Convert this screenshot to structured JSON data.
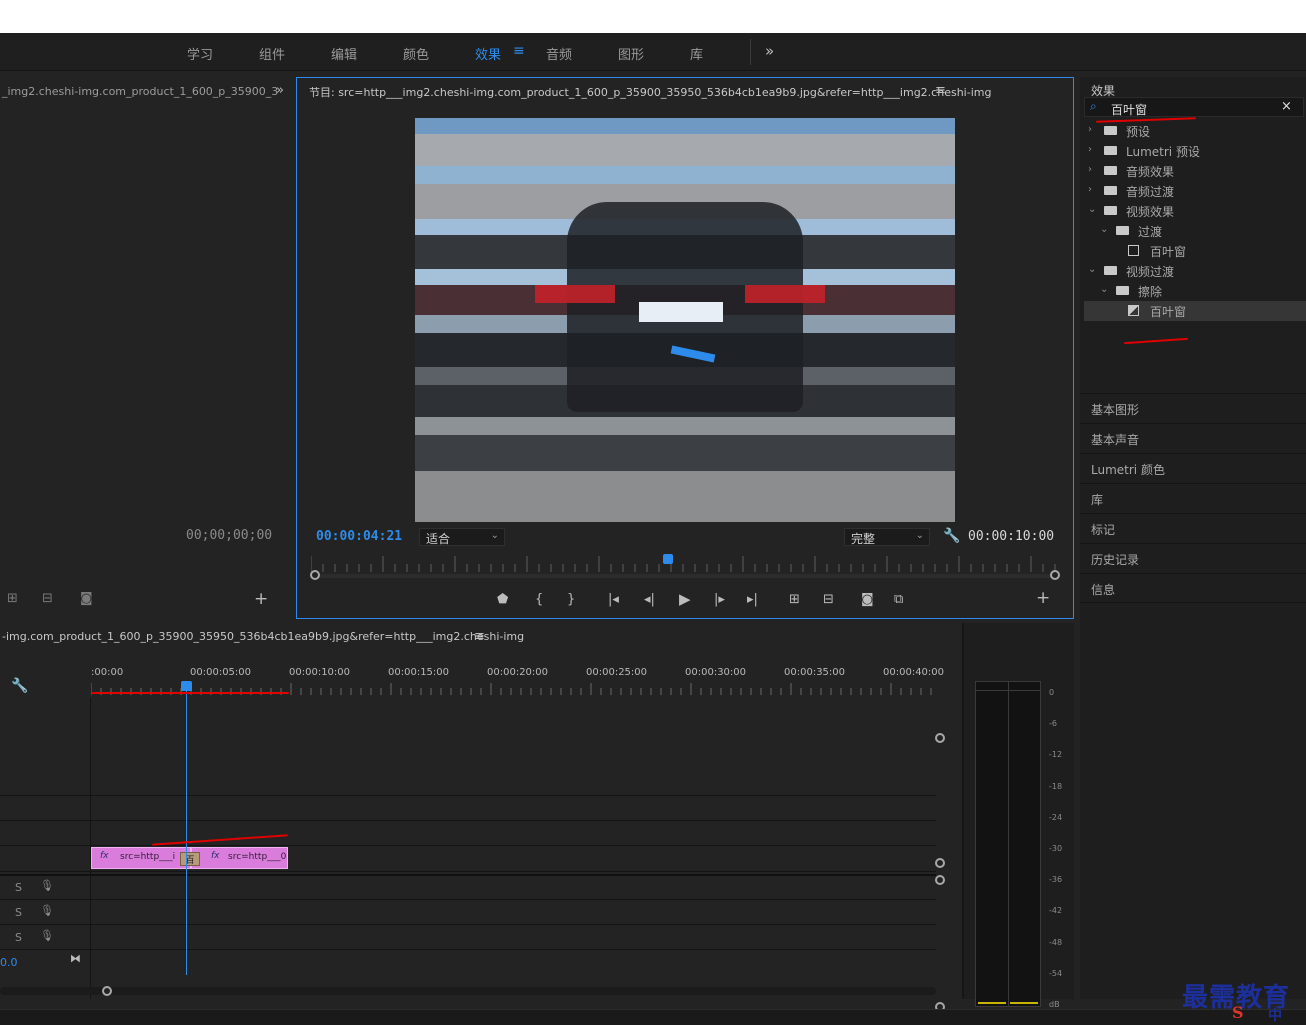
{
  "workspace": {
    "tabs": [
      "学习",
      "组件",
      "编辑",
      "颜色",
      "效果",
      "音频",
      "图形",
      "库"
    ],
    "active": "效果",
    "more_label": "»"
  },
  "source": {
    "title": "_img2.cheshi-img.com_product_1_600_p_35900_3",
    "more": "»",
    "timecode": "00;00;00;00",
    "add": "+"
  },
  "program": {
    "title": "节目: src=http___img2.cheshi-img.com_product_1_600_p_35900_35950_536b4cb1ea9b9.jpg&refer=http___img2.cheshi-img",
    "menu": "≡",
    "current_tc": "00:00:04:21",
    "fit": "适合",
    "quality": "完整",
    "duration_tc": "00:00:10:00",
    "add": "+",
    "playhead_fraction": 0.479
  },
  "effects": {
    "title": "效果",
    "search_value": "百叶窗",
    "clear": "×",
    "tree": [
      {
        "label": "预设",
        "depth": 0,
        "arrow": "›",
        "type": "folder-star"
      },
      {
        "label": "Lumetri 预设",
        "depth": 0,
        "arrow": "›",
        "type": "folder-star"
      },
      {
        "label": "音频效果",
        "depth": 0,
        "arrow": "›",
        "type": "folder"
      },
      {
        "label": "音频过渡",
        "depth": 0,
        "arrow": "›",
        "type": "folder"
      },
      {
        "label": "视频效果",
        "depth": 0,
        "arrow": "⌄",
        "type": "folder"
      },
      {
        "label": "过渡",
        "depth": 1,
        "arrow": "⌄",
        "type": "folder"
      },
      {
        "label": "百叶窗",
        "depth": 2,
        "arrow": "",
        "type": "effect"
      },
      {
        "label": "视频过渡",
        "depth": 0,
        "arrow": "⌄",
        "type": "folder"
      },
      {
        "label": "擦除",
        "depth": 1,
        "arrow": "⌄",
        "type": "folder"
      },
      {
        "label": "百叶窗",
        "depth": 2,
        "arrow": "",
        "type": "transition",
        "selected": true
      }
    ]
  },
  "right_panels": [
    "基本图形",
    "基本声音",
    "Lumetri 颜色",
    "库",
    "标记",
    "历史记录",
    "信息"
  ],
  "timeline": {
    "title": "-img.com_product_1_600_p_35900_35950_536b4cb1ea9b9.jpg&refer=http___img2.cheshi-img",
    "menu": "≡",
    "ruler": [
      ":00:00",
      "00:00:05:00",
      "00:00:10:00",
      "00:00:15:00",
      "00:00:20:00",
      "00:00:25:00",
      "00:00:30:00",
      "00:00:35:00",
      "00:00:40:00"
    ],
    "clip_a": "src=http___i",
    "clip_b": "src=http___0",
    "fx": "fx",
    "transition": "百",
    "audio_solo": "S",
    "bottom_value": "0.0"
  },
  "meter": {
    "labels": [
      "0",
      "-6",
      "-12",
      "-18",
      "-24",
      "-30",
      "-36",
      "-42",
      "-48",
      "-54",
      "dB"
    ],
    "solo": [
      "S",
      "S"
    ]
  },
  "watermark": {
    "text": "最需教育",
    "sub": "中"
  },
  "colors": {
    "accent": "#2d8ceb",
    "clip": "#d97cdc",
    "annotation": "#e00000"
  }
}
